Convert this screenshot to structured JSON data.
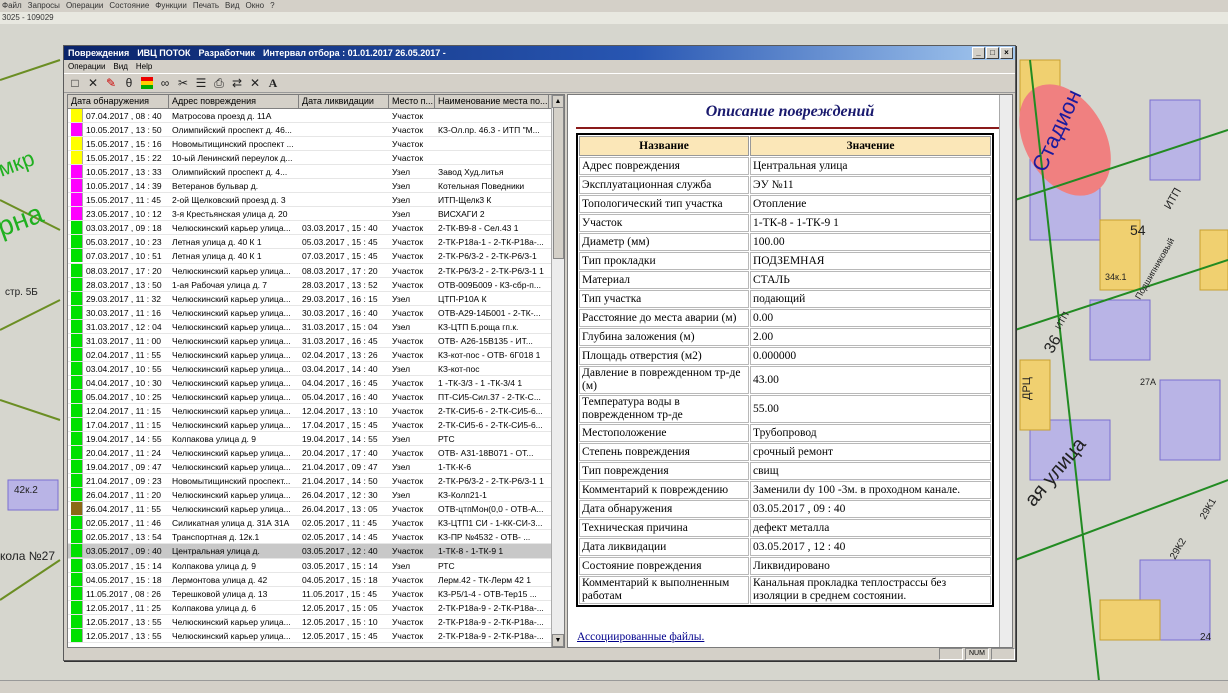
{
  "desktop": {
    "menu": [
      "Файл",
      "Запросы",
      "Операции",
      "Состояние",
      "Функции",
      "Печать",
      "Вид",
      "Окно",
      "?"
    ],
    "sub_text": "3025 - 109029",
    "map_labels": [
      "мкр",
      "рна",
      "Стадион",
      "ИТП",
      "ИТП",
      "Подшипниковый",
      "34к.1",
      "54",
      "36",
      "ДРЦ",
      "27А",
      "ая улица",
      "42к.2",
      "кола №27",
      "стр. 5Б",
      "29К2",
      "29К1",
      "24"
    ]
  },
  "window": {
    "title_app": "Повреждения",
    "title_org": "ИВЦ ПОТОК",
    "title_role": "Разработчик",
    "title_interval": "Интервал отбора :  01.01.2017   26.05.2017  -",
    "menu": [
      "Операции",
      "Вид",
      "Help"
    ],
    "statusbar": [
      "NUM"
    ]
  },
  "toolbar": {
    "icons": [
      "new-icon",
      "delete-icon",
      "edit-icon",
      "trash-icon",
      "color-flag-icon",
      "search-binoculars-icon",
      "scissors-icon",
      "list-icon",
      "print-icon",
      "link-icon",
      "close-x-icon",
      "font-icon"
    ]
  },
  "grid": {
    "headers": [
      "Дата обнаружения",
      "Адрес повреждения",
      "Дата ликвидации",
      "Место п...",
      "Наименование места по..."
    ],
    "rows": [
      {
        "color": "#ffff00",
        "date": "07.04.2017 , 08 : 40",
        "address": "Матросова проезд д. 11А",
        "liq": "",
        "place": "Участок",
        "name": ""
      },
      {
        "color": "#ff00ff",
        "date": "10.05.2017 , 13 : 50",
        "address": "Олимпийский проспект д. 46...",
        "liq": "",
        "place": "Участок",
        "name": "КЗ-Ол.пр. 46.3 - ИТП \"М..."
      },
      {
        "color": "#ffff00",
        "date": "15.05.2017 , 15 : 16",
        "address": "Новомытищинский проспект ...",
        "liq": "",
        "place": "Участок",
        "name": ""
      },
      {
        "color": "#ffff00",
        "date": "15.05.2017 , 15 : 22",
        "address": "10-ый Ленинский переулок д...",
        "liq": "",
        "place": "Участок",
        "name": ""
      },
      {
        "color": "#ff00ff",
        "date": "10.05.2017 , 13 : 33",
        "address": "Олимпийский проспект д. 4...",
        "liq": "",
        "place": "Узел",
        "name": "Завод Худ.литья"
      },
      {
        "color": "#ff00ff",
        "date": "10.05.2017 , 14 : 39",
        "address": "Ветеранов бульвар д.",
        "liq": "",
        "place": "Узел",
        "name": "Котельная Поведники"
      },
      {
        "color": "#ff00ff",
        "date": "15.05.2017 , 11 : 45",
        "address": "2-ой Щелковский проезд д. 3",
        "liq": "",
        "place": "Узел",
        "name": "ИТП-Щелк3 К"
      },
      {
        "color": "#ff00ff",
        "date": "23.05.2017 , 10 : 12",
        "address": "3-я Крестьянская улица д. 20",
        "liq": "",
        "place": "Узел",
        "name": "ВИСХАГИ 2"
      },
      {
        "color": "#00e000",
        "date": "03.03.2017 , 09 : 18",
        "address": "Челюскинский карьер улица...",
        "liq": "03.03.2017 , 15 : 40",
        "place": "Участок",
        "name": "2-ТК-В9-8 - Сел.43 1"
      },
      {
        "color": "#00e000",
        "date": "05.03.2017 , 10 : 23",
        "address": "Летная улица д. 40 К 1",
        "liq": "05.03.2017 , 15 : 45",
        "place": "Участок",
        "name": "2-ТК-Р18а-1 - 2-ТК-Р18а-..."
      },
      {
        "color": "#00e000",
        "date": "07.03.2017 , 10 : 51",
        "address": "Летная улица д. 40 К 1",
        "liq": "07.03.2017 , 15 : 45",
        "place": "Участок",
        "name": "2-ТК-Р6/3-2 - 2-ТК-Р6/3-1"
      },
      {
        "color": "#00e000",
        "date": "08.03.2017 , 17 : 20",
        "address": "Челюскинский карьер улица...",
        "liq": "08.03.2017 , 17 : 20",
        "place": "Участок",
        "name": "2-ТК-Р6/3-2 - 2-ТК-Р6/3-1 1"
      },
      {
        "color": "#00e000",
        "date": "28.03.2017 , 13 : 50",
        "address": "1-ая Рабочая улица д. 7",
        "liq": "28.03.2017 , 13 : 52",
        "place": "Участок",
        "name": "ОТВ-009Б009 - КЗ-сбр-п..."
      },
      {
        "color": "#00e000",
        "date": "29.03.2017 , 11 : 32",
        "address": "Челюскинский карьер улица...",
        "liq": "29.03.2017 , 16 : 15",
        "place": "Узел",
        "name": "ЦТП-Р10А К"
      },
      {
        "color": "#00e000",
        "date": "30.03.2017 , 11 : 16",
        "address": "Челюскинский карьер улица...",
        "liq": "30.03.2017 , 16 : 40",
        "place": "Участок",
        "name": "ОТВ-А29-14Б001 - 2-ТК-..."
      },
      {
        "color": "#00e000",
        "date": "31.03.2017 , 12 : 04",
        "address": "Челюскинский карьер улица...",
        "liq": "31.03.2017 , 15 : 04",
        "place": "Узел",
        "name": "КЗ-ЦТП Б.роща гп.к."
      },
      {
        "color": "#00e000",
        "date": "31.03.2017 , 11 : 00",
        "address": "Челюскинский карьер улица...",
        "liq": "31.03.2017 , 16 : 45",
        "place": "Участок",
        "name": "ОТВ-   А26-15В135 - ИТ..."
      },
      {
        "color": "#00e000",
        "date": "02.04.2017 , 11 : 55",
        "address": "Челюскинский карьер улица...",
        "liq": "02.04.2017 , 13 : 26",
        "place": "Участок",
        "name": "КЗ-кот-пос - ОТВ-  6Г018 1"
      },
      {
        "color": "#00e000",
        "date": "03.04.2017 , 10 : 55",
        "address": "Челюскинский карьер улица...",
        "liq": "03.04.2017 , 14 : 40",
        "place": "Узел",
        "name": "КЗ-кот-пос"
      },
      {
        "color": "#00e000",
        "date": "04.04.2017 , 10 : 30",
        "address": "Челюскинский карьер улица...",
        "liq": "04.04.2017 , 16 : 45",
        "place": "Участок",
        "name": "1 -ТК-3/3 - 1 -ТК-3/4 1"
      },
      {
        "color": "#00e000",
        "date": "05.04.2017 , 10 : 25",
        "address": "Челюскинский карьер улица...",
        "liq": "05.04.2017 , 16 : 40",
        "place": "Участок",
        "name": "ПТ-СИ5-Сил.37 - 2-ТК-С..."
      },
      {
        "color": "#00e000",
        "date": "12.04.2017 , 11 : 15",
        "address": "Челюскинский карьер улица...",
        "liq": "12.04.2017 , 13 : 10",
        "place": "Участок",
        "name": "2-ТК-СИ5-6 - 2-ТК-СИ5-6..."
      },
      {
        "color": "#00e000",
        "date": "17.04.2017 , 11 : 15",
        "address": "Челюскинский карьер улица...",
        "liq": "17.04.2017 , 15 : 45",
        "place": "Участок",
        "name": "2-ТК-СИ5-6 - 2-ТК-СИ5-6..."
      },
      {
        "color": "#00e000",
        "date": "19.04.2017 , 14 : 55",
        "address": "Колпакова улица д. 9",
        "liq": "19.04.2017 , 14 : 55",
        "place": "Узел",
        "name": "РТС"
      },
      {
        "color": "#00e000",
        "date": "20.04.2017 , 11 : 24",
        "address": "Челюскинский карьер улица...",
        "liq": "20.04.2017 , 17 : 40",
        "place": "Участок",
        "name": "ОТВ-   А31-18В071 - ОТ..."
      },
      {
        "color": "#00e000",
        "date": "19.04.2017 , 09 : 47",
        "address": "Челюскинский карьер улица...",
        "liq": "21.04.2017 , 09 : 47",
        "place": "Узел",
        "name": "1-ТК-К-6"
      },
      {
        "color": "#00e000",
        "date": "21.04.2017 , 09 : 23",
        "address": "Новомытищинский проспект...",
        "liq": "21.04.2017 , 14 : 50",
        "place": "Участок",
        "name": "2-ТК-Р6/3-2 - 2-ТК-Р6/3-1 1"
      },
      {
        "color": "#00e000",
        "date": "26.04.2017 , 11 : 20",
        "address": "Челюскинский карьер улица...",
        "liq": "26.04.2017 , 12 : 30",
        "place": "Узел",
        "name": "КЗ-Колп21-1"
      },
      {
        "color": "#8b6914",
        "date": "26.04.2017 , 11 : 55",
        "address": "Челюскинский карьер улица...",
        "liq": "26.04.2017 , 13 : 05",
        "place": "Участок",
        "name": "ОТВ-цтпМон(0,0 - ОТВ-А..."
      },
      {
        "color": "#00e000",
        "date": "02.05.2017 , 11 : 46",
        "address": "Силикатная улица д. 31А 31А",
        "liq": "02.05.2017 , 11 : 45",
        "place": "Участок",
        "name": "КЗ-ЦТП1 СИ - 1-КК-СИ-3..."
      },
      {
        "color": "#00e000",
        "date": "02.05.2017 , 13 : 54",
        "address": "Транспортная д. 12к.1",
        "liq": "02.05.2017 , 14 : 45",
        "place": "Участок",
        "name": "КЗ-ПР №4532 - ОТВ-   ..."
      },
      {
        "color": "#00e000",
        "date": "03.05.2017 , 09 : 40",
        "address": "Центральная улица д.",
        "liq": "03.05.2017 , 12 : 40",
        "place": "Участок",
        "name": "1-ТК-8 - 1-ТК-9 1",
        "selected": true
      },
      {
        "color": "#00e000",
        "date": "03.05.2017 , 15 : 14",
        "address": "Колпакова улица д. 9",
        "liq": "03.05.2017 , 15 : 14",
        "place": "Узел",
        "name": "РТС"
      },
      {
        "color": "#00e000",
        "date": "04.05.2017 , 15 : 18",
        "address": "Лермонтова улица д. 42",
        "liq": "04.05.2017 , 15 : 18",
        "place": "Участок",
        "name": "Лерм.42 - ТК-Лерм 42 1"
      },
      {
        "color": "#00e000",
        "date": "11.05.2017 , 08 : 26",
        "address": "Терешковой улица д. 13",
        "liq": "11.05.2017 , 15 : 45",
        "place": "Участок",
        "name": "КЗ-Р5/1-4 - ОТВ-Тер15 ..."
      },
      {
        "color": "#00e000",
        "date": "12.05.2017 , 11 : 25",
        "address": "Колпакова улица д. 6",
        "liq": "12.05.2017 , 15 : 05",
        "place": "Участок",
        "name": "2-ТК-Р18а-9 - 2-ТК-Р18а-..."
      },
      {
        "color": "#00e000",
        "date": "12.05.2017 , 13 : 55",
        "address": "Челюскинский карьер улица...",
        "liq": "12.05.2017 , 15 : 10",
        "place": "Участок",
        "name": "2-ТК-Р18а-9 - 2-ТК-Р18а-..."
      },
      {
        "color": "#00e000",
        "date": "12.05.2017 , 13 : 55",
        "address": "Челюскинский карьер улица...",
        "liq": "12.05.2017 , 15 : 45",
        "place": "Участок",
        "name": "2-ТК-Р18а-9 - 2-ТК-Р18а-..."
      }
    ]
  },
  "description": {
    "title": "Описание повреждений",
    "col_name": "Название",
    "col_value": "Значение",
    "rows": [
      [
        "Адрес повреждения",
        "Центральная улица"
      ],
      [
        "Эксплуатационная служба",
        "ЭУ №11"
      ],
      [
        "Топологический тип участка",
        "Отопление"
      ],
      [
        "Участок",
        "1-ТК-8 - 1-ТК-9 1"
      ],
      [
        "Диаметр (мм)",
        "100.00"
      ],
      [
        "Тип прокладки",
        "ПОДЗЕМНАЯ"
      ],
      [
        "Материал",
        "СТАЛЬ"
      ],
      [
        "Тип участка",
        "подающий"
      ],
      [
        "Расстояние до места аварии (м)",
        "0.00"
      ],
      [
        "Глубина заложения (м)",
        "2.00"
      ],
      [
        "Площадь отверстия (м2)",
        "0.000000"
      ],
      [
        "Давление в поврежденном тр-де (м)",
        "43.00"
      ],
      [
        "Температура воды в поврежденном тр-де",
        "55.00"
      ],
      [
        "Местоположение",
        "Трубопровод"
      ],
      [
        "Степень повреждения",
        "срочный ремонт"
      ],
      [
        "Тип повреждения",
        "свищ"
      ],
      [
        "Комментарий к повреждению",
        "Заменили dy 100 -3м. в проходном канале."
      ],
      [
        "Дата обнаружения",
        "03.05.2017 , 09 : 40"
      ],
      [
        "Техническая причина",
        "дефект металла"
      ],
      [
        "Дата ликвидации",
        "03.05.2017 , 12 : 40"
      ],
      [
        "Состояние повреждения",
        "Ликвидировано"
      ],
      [
        "Комментарий к выполненным работам",
        "Канальная прокладка теплострассы без изоляции в среднем состоянии."
      ]
    ],
    "assoc_link": "Ассоциированные файлы."
  }
}
